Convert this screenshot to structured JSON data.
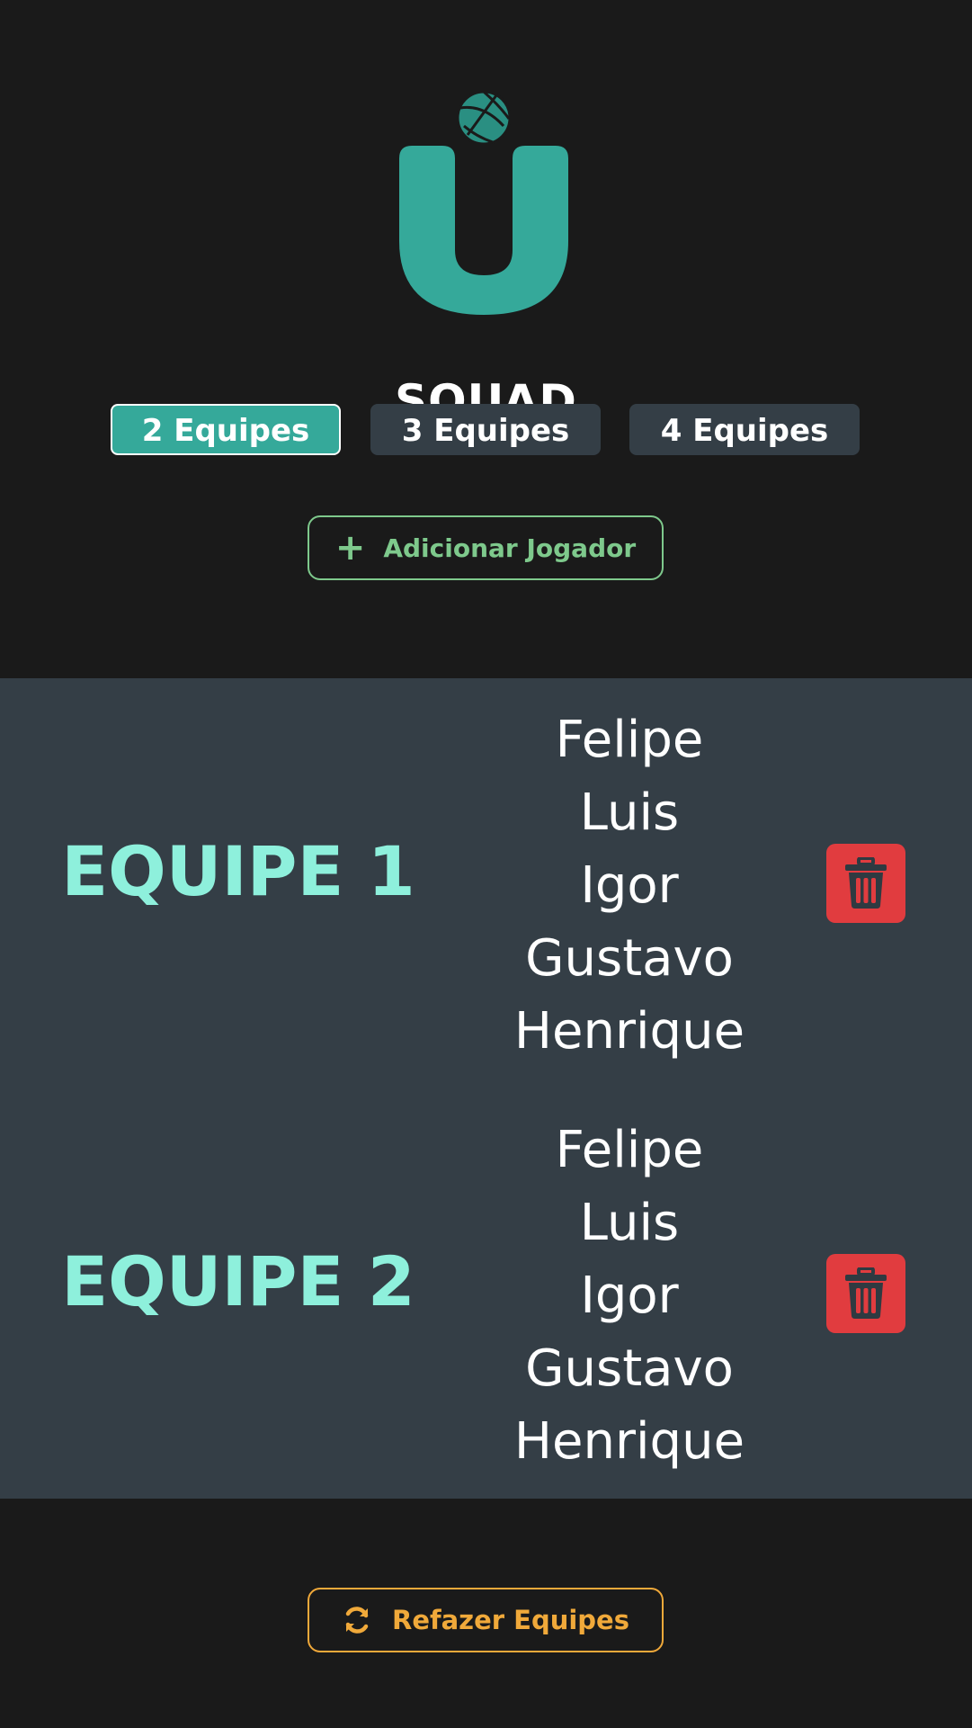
{
  "app": {
    "logo_text": "SQUAD",
    "brand_color": "#35a99a"
  },
  "team_count": {
    "options": [
      {
        "label": "2 Equipes",
        "selected": true
      },
      {
        "label": "3 Equipes",
        "selected": false
      },
      {
        "label": "4 Equipes",
        "selected": false
      }
    ]
  },
  "actions": {
    "add_player_label": "Adicionar Jogador",
    "add_player_icon": "plus-icon",
    "redo_label": "Refazer Equipes",
    "redo_icon": "refresh-icon"
  },
  "teams": [
    {
      "name": "EQUIPE 1",
      "players": [
        "Felipe",
        "Luis",
        "Igor",
        "Gustavo",
        "Henrique"
      ],
      "delete_icon": "trash-icon"
    },
    {
      "name": "EQUIPE 2",
      "players": [
        "Felipe",
        "Luis",
        "Igor",
        "Gustavo",
        "Henrique"
      ],
      "delete_icon": "trash-icon"
    }
  ],
  "colors": {
    "background": "#1a1a1a",
    "panel": "#343e46",
    "team_name": "#8ef0dc",
    "add_accent": "#7ec98c",
    "redo_accent": "#f0a93a",
    "delete": "#e13c3f"
  }
}
